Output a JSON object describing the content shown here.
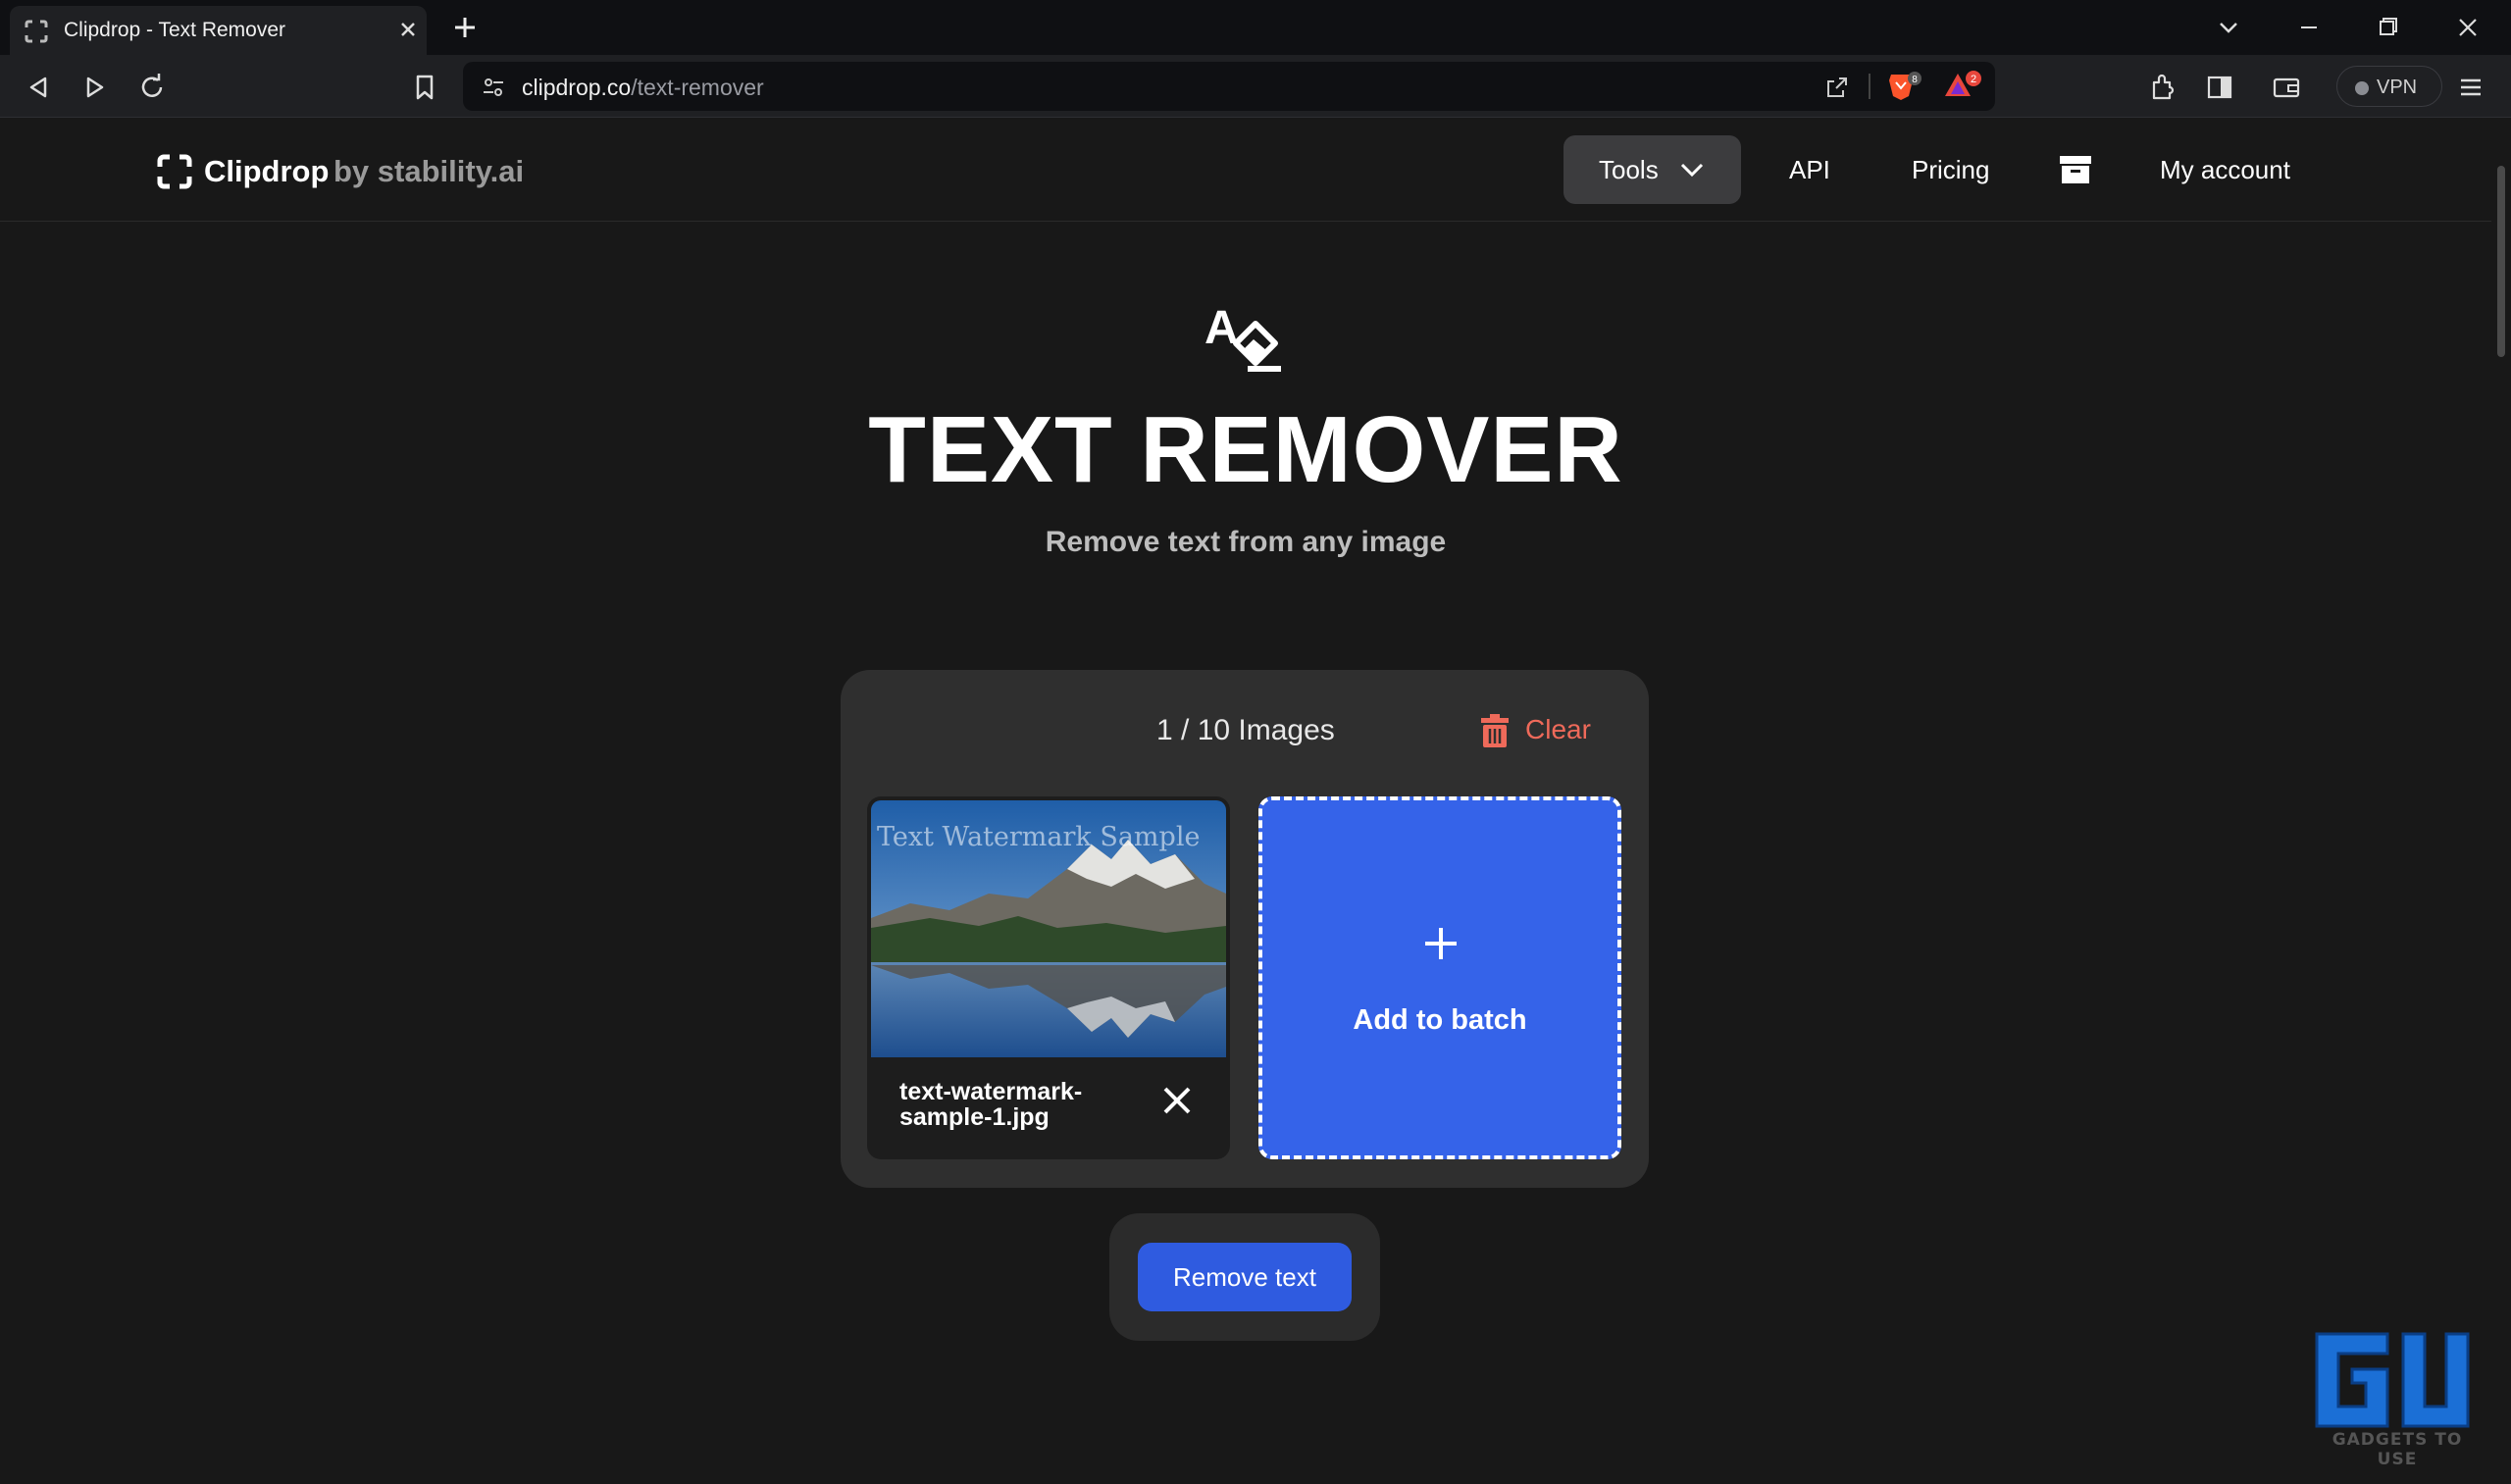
{
  "browser": {
    "tab_title": "Clipdrop - Text Remover",
    "url_host": "clipdrop.co",
    "url_path": "/text-remover",
    "brave_shield_count": "8",
    "rewards_count": "2",
    "vpn_label": "VPN"
  },
  "header": {
    "brand": "Clipdrop",
    "brand_by": "by stability.ai",
    "nav": {
      "tools": "Tools",
      "api": "API",
      "pricing": "Pricing",
      "account": "My account"
    }
  },
  "hero": {
    "title": "TEXT REMOVER",
    "subtitle": "Remove text from any image"
  },
  "batch": {
    "count": "1 / 10 Images",
    "clear_label": "Clear",
    "items": [
      {
        "filename": "text-watermark-sample-1.jpg",
        "watermark_text": "Text Watermark Sample"
      }
    ],
    "add_label": "Add to batch"
  },
  "action": {
    "remove_label": "Remove text"
  },
  "corner_logo_text": "GADGETS TO USE",
  "colors": {
    "page_bg": "#181818",
    "accent": "#3563e9",
    "danger": "#ef6a5a"
  }
}
